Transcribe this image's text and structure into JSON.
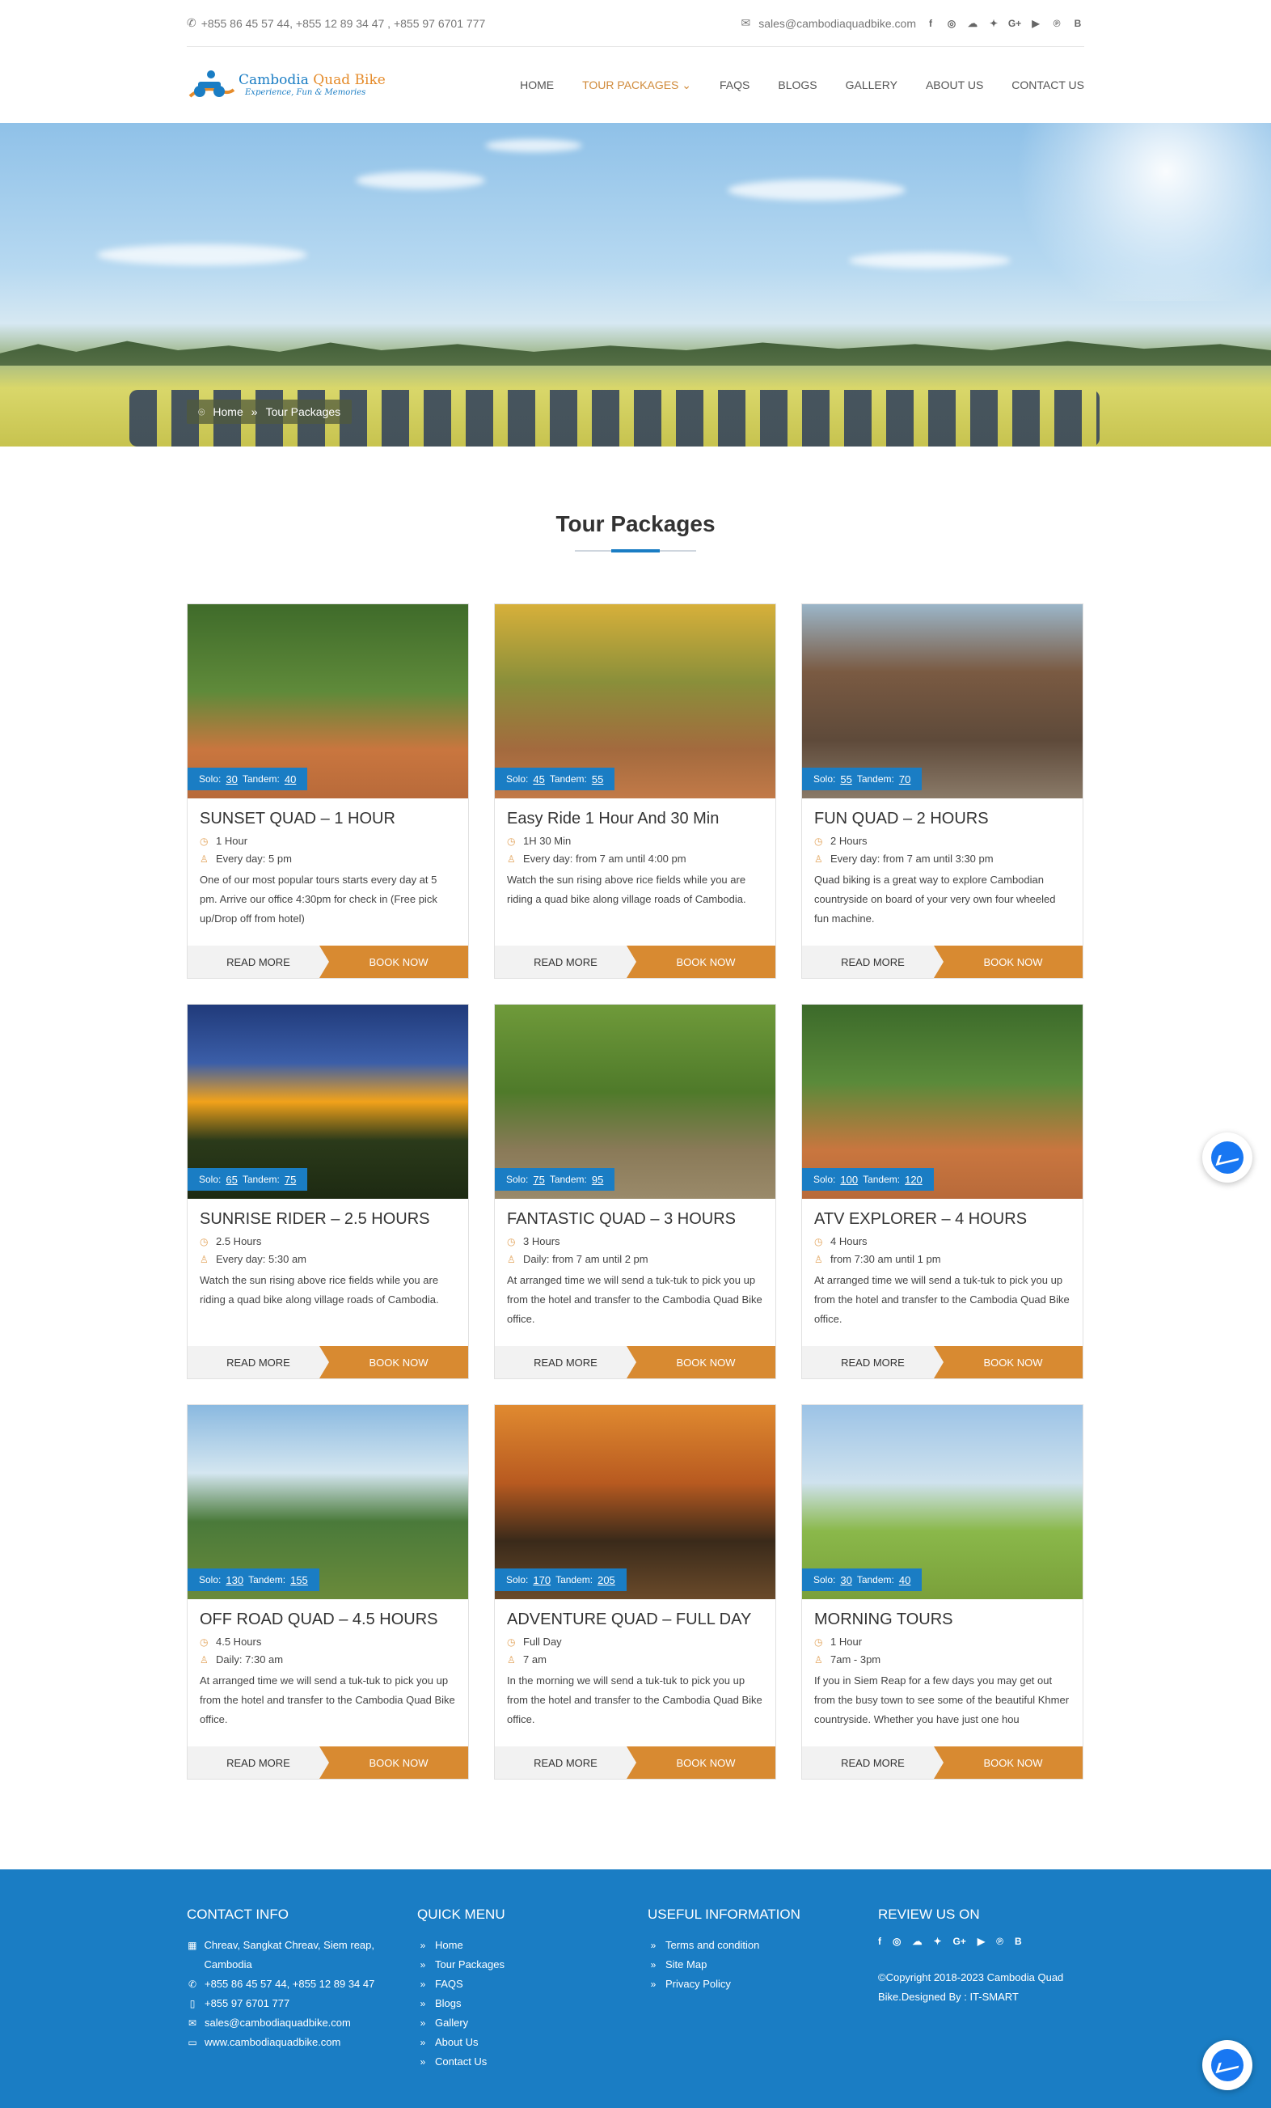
{
  "topbar": {
    "phones": "+855 86 45 57 44, +855 12 89 34 47 , +855 97 6701 777",
    "email": "sales@cambodiaquadbike.com",
    "social_icons": [
      "facebook-icon",
      "instagram-icon",
      "wechat-icon",
      "twitter-icon",
      "google-plus-icon",
      "youtube-icon",
      "pinterest-icon",
      "blogger-icon"
    ]
  },
  "logo": {
    "brand_a": "Cambodia",
    "brand_b": "Quad Bike",
    "tagline": "Experience, Fun & Memories"
  },
  "nav": {
    "home": "HOME",
    "tours": "TOUR PACKAGES",
    "faqs": "FAQS",
    "blogs": "BLOGS",
    "gallery": "GALLERY",
    "about": "ABOUT US",
    "contact": "CONTACT US"
  },
  "breadcrumb": {
    "home": "Home",
    "sep": "»",
    "current": "Tour Packages"
  },
  "section": {
    "title": "Tour Packages"
  },
  "card_labels": {
    "solo": "Solo:",
    "tandem": "Tandem:",
    "read_more": "READ MORE",
    "book_now": "BOOK NOW"
  },
  "cards": [
    {
      "title": "SUNSET QUAD – 1 HOUR",
      "solo": "30",
      "tandem": "40",
      "duration": "1 Hour",
      "schedule": "Every day: 5 pm",
      "desc": "One of our most popular tours starts every day at 5 pm. Arrive our office 4:30pm for check in (Free pick up/Drop off from hotel)"
    },
    {
      "title": "Easy Ride 1 Hour And 30 Min",
      "solo": "45",
      "tandem": "55",
      "duration": "1H 30 Min",
      "schedule": "Every day: from 7 am until 4:00 pm",
      "desc": "Watch the sun rising above rice fields while you are riding a quad bike along village roads of Cambodia."
    },
    {
      "title": "FUN QUAD – 2 HOURS",
      "solo": "55",
      "tandem": "70",
      "duration": "2 Hours",
      "schedule": "Every day: from 7 am until 3:30 pm",
      "desc": "Quad biking is a great way to explore Cambodian countryside on board of your very own four wheeled fun machine."
    },
    {
      "title": "SUNRISE RIDER – 2.5 HOURS",
      "solo": "65",
      "tandem": "75",
      "duration": "2.5 Hours",
      "schedule": "Every day: 5:30 am",
      "desc": "Watch the sun rising above rice fields while you are riding a quad bike along village roads of Cambodia."
    },
    {
      "title": "FANTASTIC QUAD – 3 HOURS",
      "solo": "75",
      "tandem": "95",
      "duration": "3 Hours",
      "schedule": "Daily: from 7 am until 2 pm",
      "desc": "At arranged time we will send a tuk-tuk to pick you up from the hotel and transfer to the Cambodia Quad Bike office."
    },
    {
      "title": "ATV EXPLORER – 4 HOURS",
      "solo": "100",
      "tandem": "120",
      "duration": "4 Hours",
      "schedule": "from 7:30 am until 1 pm",
      "desc": "At arranged time we will send a tuk-tuk to pick you up from the hotel and transfer to the Cambodia Quad Bike office."
    },
    {
      "title": "OFF ROAD QUAD – 4.5 HOURS",
      "solo": "130",
      "tandem": "155",
      "duration": "4.5 Hours",
      "schedule": "Daily: 7:30 am",
      "desc": "At arranged time we will send a tuk-tuk to pick you up from the hotel and transfer to the Cambodia Quad Bike office."
    },
    {
      "title": "ADVENTURE QUAD – FULL DAY",
      "solo": "170",
      "tandem": "205",
      "duration": "Full Day",
      "schedule": "7 am",
      "desc": "In the morning we will send a tuk-tuk to pick you up from the hotel and transfer to the Cambodia Quad Bike office."
    },
    {
      "title": "MORNING TOURS",
      "solo": "30",
      "tandem": "40",
      "duration": "1 Hour",
      "schedule": "7am - 3pm",
      "desc": "If you in Siem Reap for a few days you may get out from the busy town to see some of the beautiful Khmer countryside. Whether you have just one hou"
    }
  ],
  "footer": {
    "contact_title": "CONTACT INFO",
    "address": "Chreav, Sangkat Chreav, Siem reap, Cambodia",
    "phone": "+855 86 45 57 44, +855 12 89 34 47",
    "mobile": "+855 97 6701 777",
    "email": "sales@cambodiaquadbike.com",
    "website": "www.cambodiaquadbike.com",
    "quick_title": "QUICK MENU",
    "quick": [
      "Home",
      "Tour Packages",
      "FAQS",
      "Blogs",
      "Gallery",
      "About Us",
      "Contact Us"
    ],
    "useful_title": "USEFUL INFORMATION",
    "useful": [
      "Terms and condition",
      "Site Map",
      "Privacy Policy"
    ],
    "review_title": "REVIEW US ON",
    "copyright": "©Copyright 2018-2023 Cambodia Quad Bike.Designed By :  IT-SMART"
  },
  "colors": {
    "brand_blue": "#1a7dc4",
    "accent_orange": "#d88a31"
  }
}
